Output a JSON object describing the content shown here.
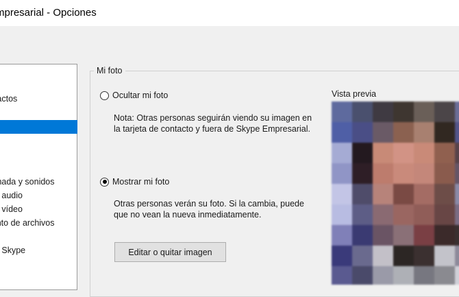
{
  "window": {
    "title": "mpresarial - Opciones"
  },
  "nav": {
    "items": [
      {
        "label": "ntactos",
        "selected": false
      },
      {
        "label": "",
        "selected": true
      },
      {
        "label": "amada y sonidos",
        "selected": false
      },
      {
        "label": "de audio",
        "selected": false
      },
      {
        "label": "de vídeo",
        "selected": false
      },
      {
        "label": "iento de archivos",
        "selected": false
      },
      {
        "label": "de Skype",
        "selected": false
      }
    ]
  },
  "photo_group": {
    "legend": "Mi foto",
    "hide_option": {
      "label": "Ocultar mi foto",
      "checked": false,
      "note_line1": "Nota: Otras personas seguirán viendo su imagen en",
      "note_line2": "la tarjeta de contacto y fuera de Skype Empresarial."
    },
    "show_option": {
      "label": "Mostrar mi foto",
      "checked": true,
      "note_line1": "Otras personas verán su foto. Si la cambia, puede",
      "note_line2": "que no vean la nueva inmediatamente."
    },
    "edit_button": "Editar o quitar imagen",
    "preview_label": "Vista previa"
  },
  "preview_pixels": [
    [
      "#5e6a9e",
      "#4a506e",
      "#3f3a42",
      "#3e3630",
      "#6a5f58",
      "#4b4548",
      "#6b6e98"
    ],
    [
      "#4f5fa6",
      "#4a4e86",
      "#6a5a66",
      "#8b6150",
      "#a88070",
      "#312821",
      "#53558a"
    ],
    [
      "#a5abd4",
      "#23191f",
      "#c88a77",
      "#d29385",
      "#c98a78",
      "#90604f",
      "#58434a"
    ],
    [
      "#9095c6",
      "#2e1e26",
      "#bd7c6d",
      "#c98a7b",
      "#c4877a",
      "#8a5b4d",
      "#665566"
    ],
    [
      "#c3c5e6",
      "#4f4c6a",
      "#b7837a",
      "#7a4a44",
      "#a46c64",
      "#6d4d48",
      "#8a8aa8"
    ],
    [
      "#b8bce2",
      "#5d5d86",
      "#8a6a72",
      "#9a6661",
      "#905d58",
      "#684645",
      "#7a6c84"
    ],
    [
      "#8080b8",
      "#3a3a72",
      "#6a5464",
      "#8a7077",
      "#7a3f44",
      "#3b2a2a",
      "#3a3030"
    ],
    [
      "#3a3a7a",
      "#6a6a8e",
      "#c3c0c8",
      "#2c2624",
      "#3b3030",
      "#c3c3ca",
      "#8d8a9a"
    ],
    [
      "#5a5a90",
      "#4a4a6a",
      "#9a9aa8",
      "#aeb0b6",
      "#777780",
      "#8a8a90",
      "#d0d0d8"
    ]
  ],
  "colors": {
    "selection": "#0078d7"
  }
}
